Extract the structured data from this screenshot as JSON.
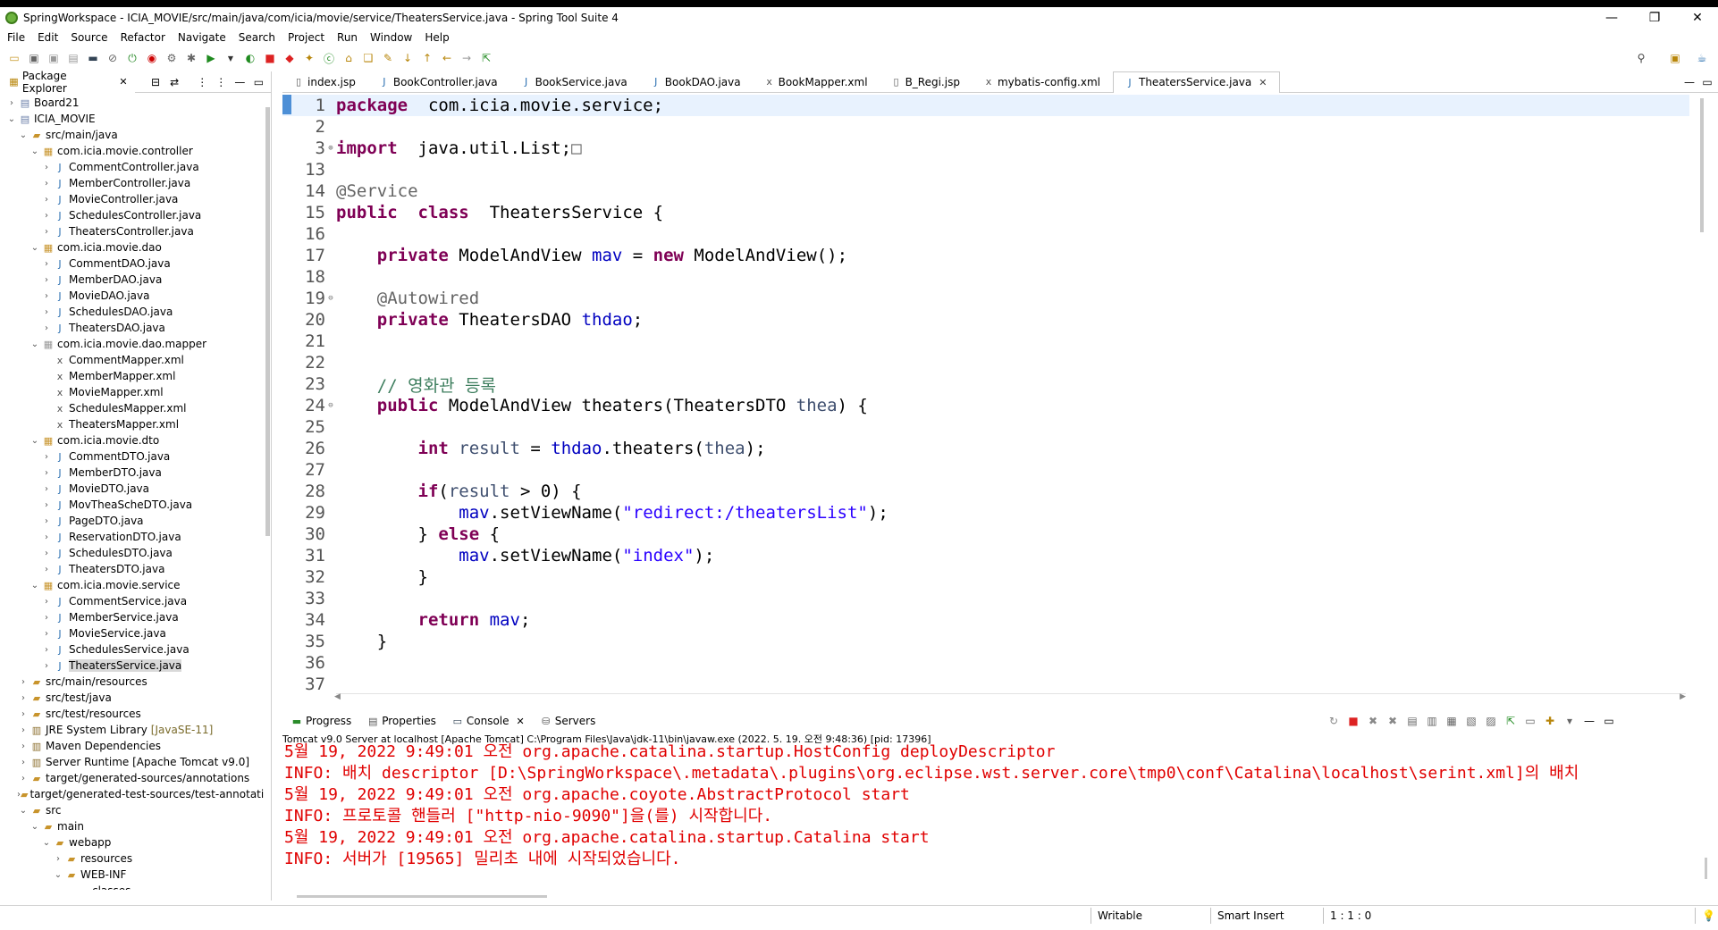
{
  "window": {
    "title": "SpringWorkspace - ICIA_MOVIE/src/main/java/com/icia/movie/service/TheatersService.java - Spring Tool Suite 4",
    "minimize": "—",
    "maximize": "❐",
    "close": "✕"
  },
  "menu": [
    "File",
    "Edit",
    "Source",
    "Refactor",
    "Navigate",
    "Search",
    "Project",
    "Run",
    "Window",
    "Help"
  ],
  "package_explorer": {
    "tab_label": "Package Explorer",
    "tree": [
      {
        "depth": 0,
        "twisty": "›",
        "icon": "project-icon",
        "label": "Board21"
      },
      {
        "depth": 0,
        "twisty": "⌄",
        "icon": "project-icon",
        "label": "ICIA_MOVIE"
      },
      {
        "depth": 1,
        "twisty": "⌄",
        "icon": "source-folder-icon",
        "label": "src/main/java"
      },
      {
        "depth": 2,
        "twisty": "⌄",
        "icon": "package-icon",
        "label": "com.icia.movie.controller"
      },
      {
        "depth": 3,
        "twisty": "›",
        "icon": "java-file-icon",
        "label": "CommentController.java"
      },
      {
        "depth": 3,
        "twisty": "›",
        "icon": "java-file-icon",
        "label": "MemberController.java"
      },
      {
        "depth": 3,
        "twisty": "›",
        "icon": "java-file-icon",
        "label": "MovieController.java"
      },
      {
        "depth": 3,
        "twisty": "›",
        "icon": "java-file-icon",
        "label": "SchedulesController.java"
      },
      {
        "depth": 3,
        "twisty": "›",
        "icon": "java-file-icon",
        "label": "TheatersController.java"
      },
      {
        "depth": 2,
        "twisty": "⌄",
        "icon": "package-icon",
        "label": "com.icia.movie.dao"
      },
      {
        "depth": 3,
        "twisty": "›",
        "icon": "java-file-icon",
        "label": "CommentDAO.java"
      },
      {
        "depth": 3,
        "twisty": "›",
        "icon": "java-file-icon",
        "label": "MemberDAO.java"
      },
      {
        "depth": 3,
        "twisty": "›",
        "icon": "java-file-icon",
        "label": "MovieDAO.java"
      },
      {
        "depth": 3,
        "twisty": "›",
        "icon": "java-file-icon",
        "label": "SchedulesDAO.java"
      },
      {
        "depth": 3,
        "twisty": "›",
        "icon": "java-file-icon",
        "label": "TheatersDAO.java"
      },
      {
        "depth": 2,
        "twisty": "⌄",
        "icon": "package-empty-icon",
        "label": "com.icia.movie.dao.mapper"
      },
      {
        "depth": 3,
        "twisty": "",
        "icon": "xml-file-icon",
        "label": "CommentMapper.xml"
      },
      {
        "depth": 3,
        "twisty": "",
        "icon": "xml-file-icon",
        "label": "MemberMapper.xml"
      },
      {
        "depth": 3,
        "twisty": "",
        "icon": "xml-file-icon",
        "label": "MovieMapper.xml"
      },
      {
        "depth": 3,
        "twisty": "",
        "icon": "xml-file-icon",
        "label": "SchedulesMapper.xml"
      },
      {
        "depth": 3,
        "twisty": "",
        "icon": "xml-file-icon",
        "label": "TheatersMapper.xml"
      },
      {
        "depth": 2,
        "twisty": "⌄",
        "icon": "package-icon",
        "label": "com.icia.movie.dto"
      },
      {
        "depth": 3,
        "twisty": "›",
        "icon": "java-file-icon",
        "label": "CommentDTO.java"
      },
      {
        "depth": 3,
        "twisty": "›",
        "icon": "java-file-icon",
        "label": "MemberDTO.java"
      },
      {
        "depth": 3,
        "twisty": "›",
        "icon": "java-file-icon",
        "label": "MovieDTO.java"
      },
      {
        "depth": 3,
        "twisty": "›",
        "icon": "java-file-icon",
        "label": "MovTheaScheDTO.java"
      },
      {
        "depth": 3,
        "twisty": "›",
        "icon": "java-file-icon",
        "label": "PageDTO.java"
      },
      {
        "depth": 3,
        "twisty": "›",
        "icon": "java-file-icon",
        "label": "ReservationDTO.java"
      },
      {
        "depth": 3,
        "twisty": "›",
        "icon": "java-file-icon",
        "label": "SchedulesDTO.java"
      },
      {
        "depth": 3,
        "twisty": "›",
        "icon": "java-file-icon",
        "label": "TheatersDTO.java"
      },
      {
        "depth": 2,
        "twisty": "⌄",
        "icon": "package-icon",
        "label": "com.icia.movie.service"
      },
      {
        "depth": 3,
        "twisty": "›",
        "icon": "java-file-icon",
        "label": "CommentService.java"
      },
      {
        "depth": 3,
        "twisty": "›",
        "icon": "java-file-icon",
        "label": "MemberService.java"
      },
      {
        "depth": 3,
        "twisty": "›",
        "icon": "java-file-icon",
        "label": "MovieService.java"
      },
      {
        "depth": 3,
        "twisty": "›",
        "icon": "java-file-icon",
        "label": "SchedulesService.java"
      },
      {
        "depth": 3,
        "twisty": "›",
        "icon": "java-file-icon",
        "label": "TheatersService.java",
        "selected": true
      },
      {
        "depth": 1,
        "twisty": "›",
        "icon": "source-folder-icon",
        "label": "src/main/resources"
      },
      {
        "depth": 1,
        "twisty": "›",
        "icon": "source-folder-icon",
        "label": "src/test/java"
      },
      {
        "depth": 1,
        "twisty": "›",
        "icon": "source-folder-icon",
        "label": "src/test/resources"
      },
      {
        "depth": 1,
        "twisty": "›",
        "icon": "library-icon",
        "label": "JRE System Library",
        "decor": "[JavaSE-11]"
      },
      {
        "depth": 1,
        "twisty": "›",
        "icon": "library-icon",
        "label": "Maven Dependencies"
      },
      {
        "depth": 1,
        "twisty": "›",
        "icon": "library-icon",
        "label": "Server Runtime [Apache Tomcat v9.0]"
      },
      {
        "depth": 1,
        "twisty": "›",
        "icon": "folder-icon",
        "label": "target/generated-sources/annotations"
      },
      {
        "depth": 1,
        "twisty": "›",
        "icon": "folder-icon",
        "label": "target/generated-test-sources/test-annotatic"
      },
      {
        "depth": 1,
        "twisty": "⌄",
        "icon": "folder-icon",
        "label": "src"
      },
      {
        "depth": 2,
        "twisty": "⌄",
        "icon": "folder-icon",
        "label": "main"
      },
      {
        "depth": 3,
        "twisty": "⌄",
        "icon": "folder-icon",
        "label": "webapp"
      },
      {
        "depth": 4,
        "twisty": "›",
        "icon": "folder-icon",
        "label": "resources"
      },
      {
        "depth": 4,
        "twisty": "⌄",
        "icon": "folder-icon",
        "label": "WEB-INF"
      },
      {
        "depth": 5,
        "twisty": "",
        "icon": "folder-icon",
        "label": "classes"
      }
    ]
  },
  "editor": {
    "tabs": [
      {
        "label": "index.jsp",
        "icon": "jsp-file-icon"
      },
      {
        "label": "BookController.java",
        "icon": "java-file-icon"
      },
      {
        "label": "BookService.java",
        "icon": "java-file-icon"
      },
      {
        "label": "BookDAO.java",
        "icon": "java-file-icon"
      },
      {
        "label": "BookMapper.xml",
        "icon": "xml-file-icon"
      },
      {
        "label": "B_Regi.jsp",
        "icon": "jsp-file-icon"
      },
      {
        "label": "mybatis-config.xml",
        "icon": "xml-file-icon"
      },
      {
        "label": "TheatersService.java",
        "icon": "java-file-icon",
        "active": true
      }
    ],
    "lines": [
      {
        "n": "1",
        "fold": "",
        "current": true,
        "tokens": [
          [
            "kw",
            "package"
          ],
          [
            "",
            "  com.icia.movie.service;"
          ]
        ]
      },
      {
        "n": "2",
        "fold": "",
        "tokens": []
      },
      {
        "n": "3",
        "fold": "⊕",
        "tokens": [
          [
            "kw",
            "import"
          ],
          [
            "",
            "  java.util.List;"
          ],
          [
            "box",
            "□"
          ]
        ]
      },
      {
        "n": "13",
        "fold": "",
        "tokens": []
      },
      {
        "n": "14",
        "fold": "",
        "tokens": [
          [
            "ann",
            "@Service"
          ]
        ]
      },
      {
        "n": "15",
        "fold": "",
        "tokens": [
          [
            "kw",
            "public"
          ],
          [
            "",
            "  "
          ],
          [
            "kw",
            "class"
          ],
          [
            "",
            "  TheatersService {"
          ]
        ]
      },
      {
        "n": "16",
        "fold": "",
        "tokens": []
      },
      {
        "n": "17",
        "fold": "",
        "tokens": [
          [
            "",
            "    "
          ],
          [
            "kw",
            "private"
          ],
          [
            "",
            " ModelAndView "
          ],
          [
            "fld",
            "mav"
          ],
          [
            "",
            " = "
          ],
          [
            "kw",
            "new"
          ],
          [
            "",
            " ModelAndView();"
          ]
        ]
      },
      {
        "n": "18",
        "fold": "",
        "tokens": []
      },
      {
        "n": "19",
        "fold": "⊖",
        "tokens": [
          [
            "",
            "    "
          ],
          [
            "ann",
            "@Autowired"
          ]
        ]
      },
      {
        "n": "20",
        "fold": "",
        "tokens": [
          [
            "",
            "    "
          ],
          [
            "kw",
            "private"
          ],
          [
            "",
            " TheatersDAO "
          ],
          [
            "fld",
            "thdao"
          ],
          [
            "",
            ";"
          ]
        ]
      },
      {
        "n": "21",
        "fold": "",
        "tokens": []
      },
      {
        "n": "22",
        "fold": "",
        "tokens": []
      },
      {
        "n": "23",
        "fold": "",
        "tokens": [
          [
            "",
            "    "
          ],
          [
            "cmt",
            "// 영화관 등록"
          ]
        ]
      },
      {
        "n": "24",
        "fold": "⊖",
        "tokens": [
          [
            "",
            "    "
          ],
          [
            "kw",
            "public"
          ],
          [
            "",
            " ModelAndView theaters(TheatersDTO "
          ],
          [
            "lm",
            "thea"
          ],
          [
            "",
            ") {"
          ]
        ]
      },
      {
        "n": "25",
        "fold": "",
        "tokens": []
      },
      {
        "n": "26",
        "fold": "",
        "tokens": [
          [
            "",
            "        "
          ],
          [
            "kw",
            "int"
          ],
          [
            "",
            " "
          ],
          [
            "lm",
            "result"
          ],
          [
            "",
            " = "
          ],
          [
            "fld",
            "thdao"
          ],
          [
            "",
            ".theaters("
          ],
          [
            "lm",
            "thea"
          ],
          [
            "",
            ");"
          ]
        ]
      },
      {
        "n": "27",
        "fold": "",
        "tokens": []
      },
      {
        "n": "28",
        "fold": "",
        "tokens": [
          [
            "",
            "        "
          ],
          [
            "kw",
            "if"
          ],
          [
            "",
            "("
          ],
          [
            "lm",
            "result"
          ],
          [
            "",
            " > 0) {"
          ]
        ]
      },
      {
        "n": "29",
        "fold": "",
        "tokens": [
          [
            "",
            "            "
          ],
          [
            "fld",
            "mav"
          ],
          [
            "",
            ".setViewName("
          ],
          [
            "str",
            "\"redirect:/theatersList\""
          ],
          [
            "",
            ");"
          ]
        ]
      },
      {
        "n": "30",
        "fold": "",
        "tokens": [
          [
            "",
            "        } "
          ],
          [
            "kw",
            "else"
          ],
          [
            "",
            " {"
          ]
        ]
      },
      {
        "n": "31",
        "fold": "",
        "tokens": [
          [
            "",
            "            "
          ],
          [
            "fld",
            "mav"
          ],
          [
            "",
            ".setViewName("
          ],
          [
            "str",
            "\"index\""
          ],
          [
            "",
            ");"
          ]
        ]
      },
      {
        "n": "32",
        "fold": "",
        "tokens": [
          [
            "",
            "        }"
          ]
        ]
      },
      {
        "n": "33",
        "fold": "",
        "tokens": []
      },
      {
        "n": "34",
        "fold": "",
        "tokens": [
          [
            "",
            "        "
          ],
          [
            "kw",
            "return"
          ],
          [
            "",
            " "
          ],
          [
            "fld",
            "mav"
          ],
          [
            "",
            ";"
          ]
        ]
      },
      {
        "n": "35",
        "fold": "",
        "tokens": [
          [
            "",
            "    }"
          ]
        ]
      },
      {
        "n": "36",
        "fold": "",
        "tokens": []
      },
      {
        "n": "37",
        "fold": "",
        "tokens": []
      }
    ]
  },
  "console": {
    "tabs": [
      {
        "label": "Progress",
        "icon": "progress-icon"
      },
      {
        "label": "Properties",
        "icon": "properties-icon"
      },
      {
        "label": "Console",
        "icon": "console-icon",
        "active": true
      },
      {
        "label": "Servers",
        "icon": "servers-icon"
      }
    ],
    "info": "Tomcat v9.0 Server at localhost [Apache Tomcat] C:\\Program Files\\Java\\jdk-11\\bin\\javaw.exe  (2022. 5. 19. 오전 9:48:36) [pid: 17396]",
    "lines": [
      "5월 19, 2022 9:49:01 오전 org.apache.catalina.startup.HostConfig deployDescriptor",
      "INFO: 배치 descriptor [D:\\SpringWorkspace\\.metadata\\.plugins\\org.eclipse.wst.server.core\\tmp0\\conf\\Catalina\\localhost\\serint.xml]의 배치",
      "5월 19, 2022 9:49:01 오전 org.apache.coyote.AbstractProtocol start",
      "INFO: 프로토콜 핸들러 [\"http-nio-9090\"]을(를) 시작합니다.",
      "5월 19, 2022 9:49:01 오전 org.apache.catalina.startup.Catalina start",
      "INFO: 서버가 [19565] 밀리초 내에 시작되었습니다."
    ]
  },
  "status": {
    "writable": "Writable",
    "insert_mode": "Smart Insert",
    "position": "1 : 1 : 0"
  }
}
